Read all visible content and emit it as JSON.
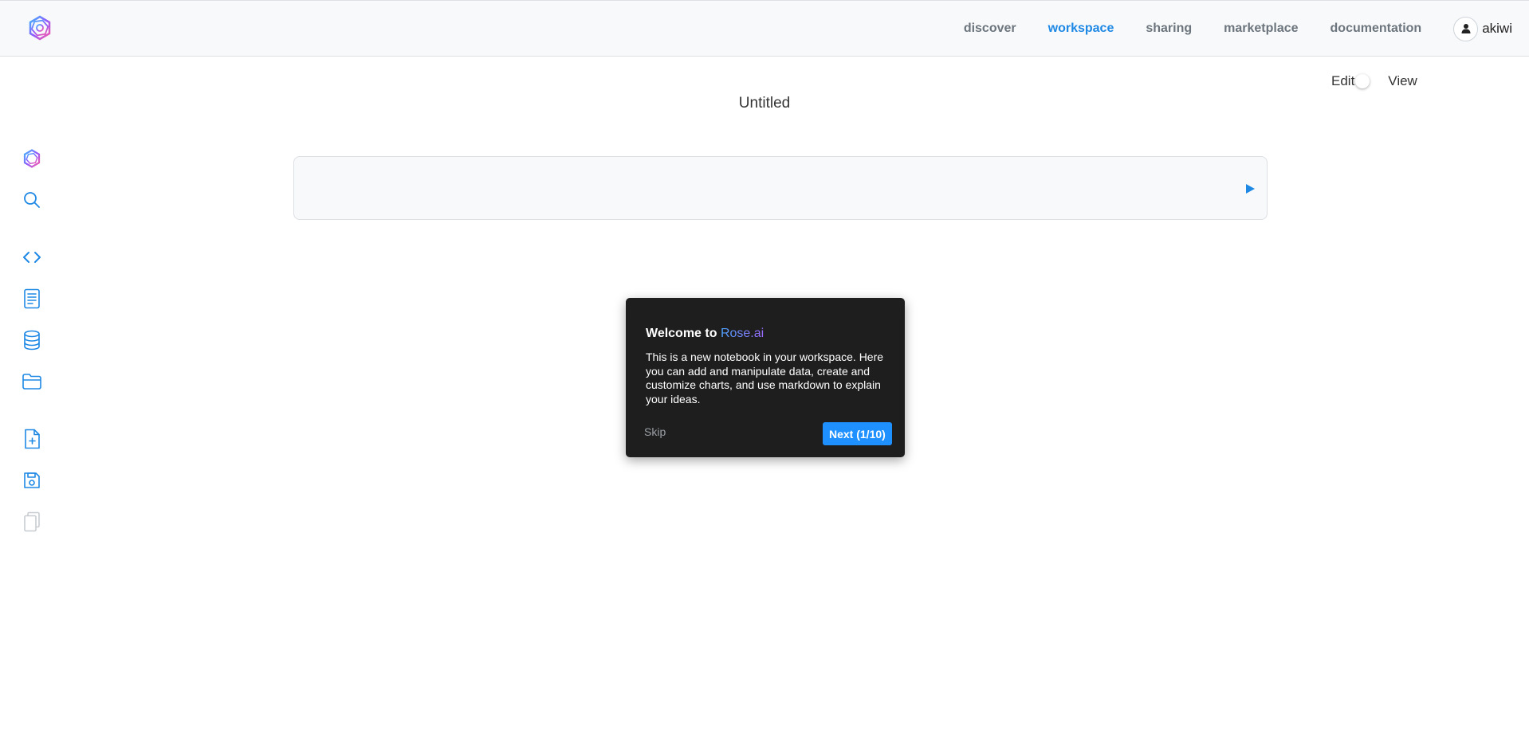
{
  "nav": {
    "links": [
      "discover",
      "workspace",
      "sharing",
      "marketplace",
      "documentation"
    ],
    "active": "workspace",
    "user": "akiwi"
  },
  "mode_toggle": {
    "left_label": "Edit",
    "right_label": "View"
  },
  "notebook": {
    "title": "Untitled"
  },
  "sidebar": {
    "icons": [
      "rose-logo-icon",
      "search-icon",
      "code-icon",
      "document-icon",
      "database-icon",
      "folder-icon",
      "new-file-icon",
      "save-icon",
      "copy-icon"
    ]
  },
  "tour": {
    "title_prefix": "Welcome to ",
    "brand": "Rose.ai",
    "body": "This is a new notebook in your workspace. Here you can add and manipulate data, create and customize charts, and use markdown to explain your ideas.",
    "skip_label": "Skip",
    "next_label": "Next (1/10)"
  },
  "colors": {
    "accent": "#1e88e5",
    "tour_bg": "#1e1e1e",
    "next_button": "#1e90ff"
  }
}
